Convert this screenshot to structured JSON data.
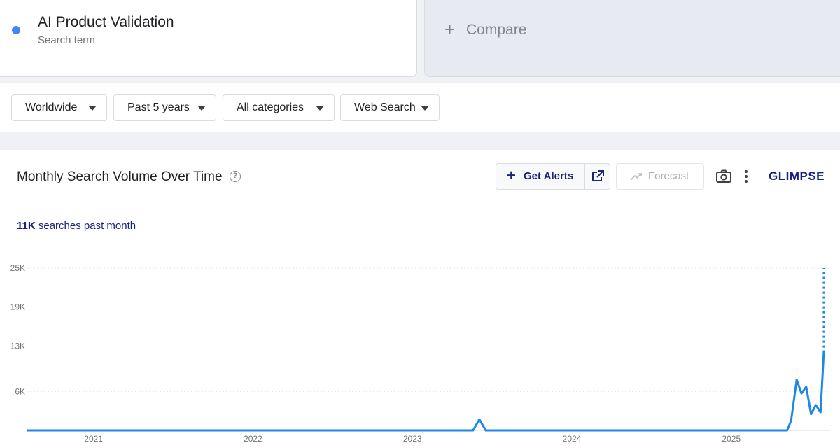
{
  "term": {
    "name": "AI Product Validation",
    "subtitle": "Search term",
    "dot_color": "#4285f4"
  },
  "compare": {
    "plus": "+",
    "label": "Compare"
  },
  "filters": [
    {
      "label": "Worldwide"
    },
    {
      "label": "Past 5 years"
    },
    {
      "label": "All categories"
    },
    {
      "label": "Web Search"
    }
  ],
  "panel": {
    "title": "Monthly Search Volume Over Time",
    "help": "?",
    "get_alerts": "Get Alerts",
    "forecast": "Forecast",
    "logo": "GLIMPSE",
    "summary_number": "11K",
    "summary_text": " searches past month",
    "icons": [
      "plus-icon",
      "external-link-icon",
      "trend-icon",
      "camera-icon",
      "more-vert-icon"
    ]
  },
  "chart_data": {
    "type": "line",
    "y_ticks": [
      "25K",
      "19K",
      "13K",
      "6K"
    ],
    "y_tick_values": [
      25000,
      19000,
      13000,
      6000
    ],
    "ylim": [
      0,
      25000
    ],
    "x_ticks": [
      "2021",
      "2022",
      "2023",
      "2024",
      "2025"
    ],
    "x_tick_years": [
      2021,
      2022,
      2023,
      2024,
      2025
    ],
    "xlim": [
      2020.58,
      2025.62
    ],
    "grid": true,
    "line_color": "#1e88e5",
    "series": [
      {
        "x": [
          2020.58,
          2023.38,
          2023.42,
          2023.46,
          2025.35,
          2025.375,
          2025.41,
          2025.44,
          2025.47,
          2025.5,
          2025.53,
          2025.56,
          2025.58
        ],
        "y": [
          0,
          0,
          1700,
          0,
          0,
          1500,
          7800,
          5700,
          6700,
          2500,
          3900,
          2800,
          12000
        ]
      }
    ],
    "projection": {
      "x": [
        2025.58,
        2025.58
      ],
      "y": [
        12000,
        25000
      ]
    }
  }
}
